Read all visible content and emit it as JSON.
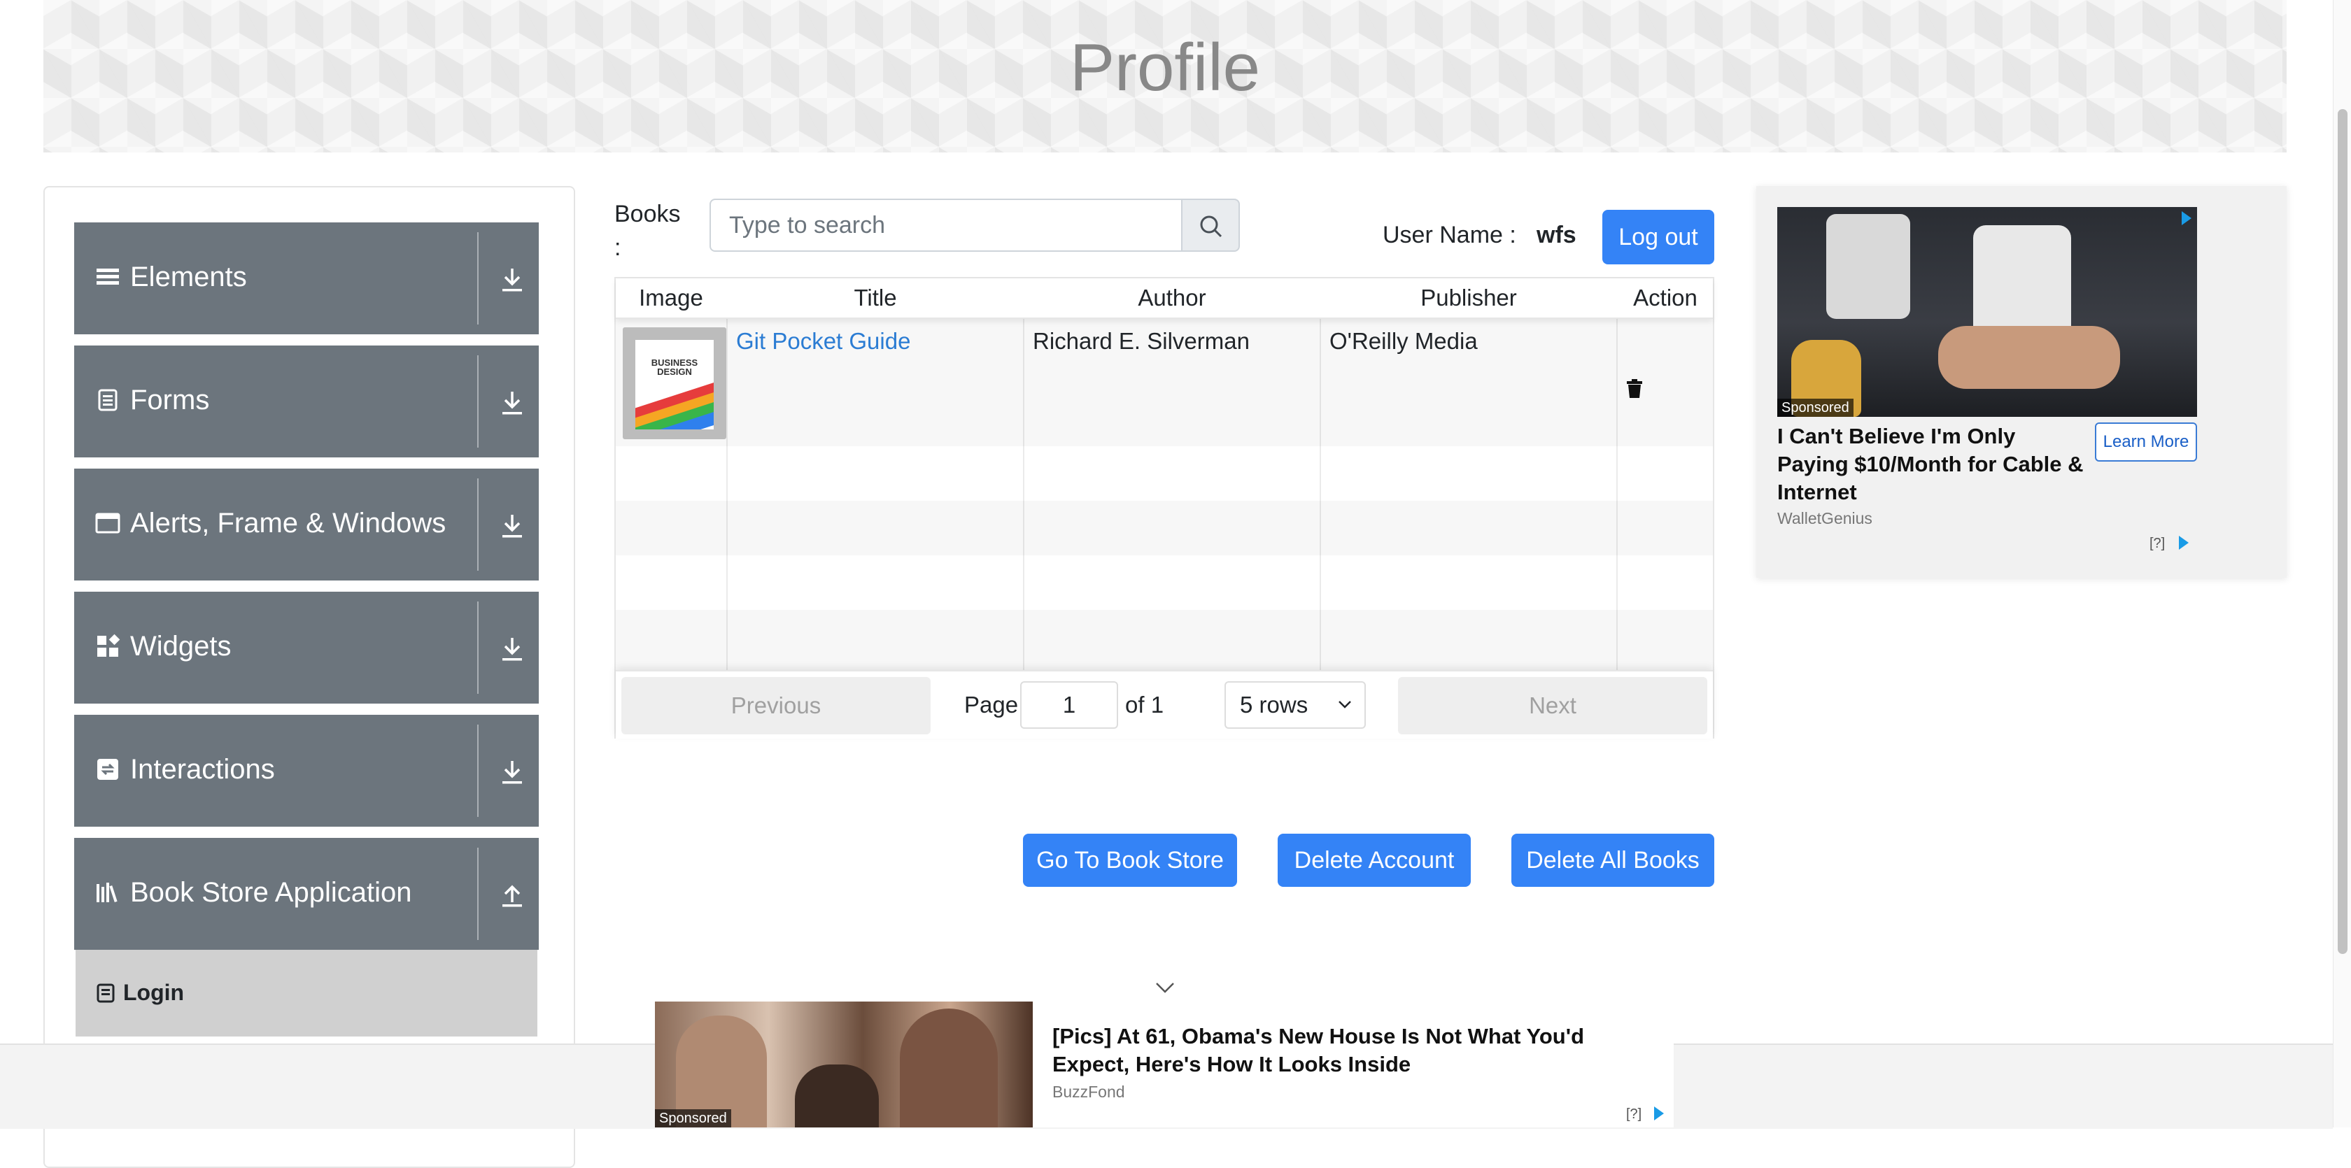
{
  "header": {
    "title": "Profile"
  },
  "sidebar": {
    "groups": [
      {
        "label": "Elements",
        "icon": "menu-icon",
        "arrow": "download-icon"
      },
      {
        "label": "Forms",
        "icon": "form-icon",
        "arrow": "download-icon"
      },
      {
        "label": "Alerts, Frame & Windows",
        "icon": "window-icon",
        "arrow": "download-icon"
      },
      {
        "label": "Widgets",
        "icon": "widgets-icon",
        "arrow": "download-icon"
      },
      {
        "label": "Interactions",
        "icon": "interactions-icon",
        "arrow": "download-icon"
      },
      {
        "label": "Book Store Application",
        "icon": "books-icon",
        "arrow": "upload-icon"
      }
    ],
    "active_item": {
      "label": "Login",
      "icon": "login-icon"
    }
  },
  "search": {
    "label": "Books :",
    "placeholder": "Type to search",
    "icon": "search-icon"
  },
  "user": {
    "name_label": "User Name :",
    "name_value": "wfs",
    "logout_label": "Log out"
  },
  "table": {
    "headers": [
      "Image",
      "Title",
      "Author",
      "Publisher",
      "Action"
    ],
    "rows": [
      {
        "image_text": "BUSINESS DESIGN",
        "title": "Git Pocket Guide",
        "author": "Richard E. Silverman",
        "publisher": "O'Reilly Media",
        "action_icon": "trash-icon"
      }
    ]
  },
  "pagination": {
    "previous_label": "Previous",
    "page_label": "Page",
    "page_value": "1",
    "of_label": "of 1",
    "rows_option": "5 rows",
    "next_label": "Next"
  },
  "actions": {
    "go_to_store": "Go To Book Store",
    "delete_account": "Delete Account",
    "delete_all": "Delete All Books"
  },
  "ad_right": {
    "sponsored": "Sponsored",
    "headline": "I Can't Believe I'm Only Paying $10/Month for Cable & Internet",
    "cta": "Learn More",
    "source": "WalletGenius",
    "adchoices": "[?]"
  },
  "ad_bottom": {
    "sponsored": "Sponsored",
    "headline": "[Pics] At 61, Obama's New House Is Not What You'd Expect, Here's How It Looks Inside",
    "source": "BuzzFond",
    "adchoices": "[?]"
  },
  "colors": {
    "primary": "#3483f6",
    "sidebar_group": "#6c757d",
    "link": "#2b7cd3",
    "active_item": "#d0d0d0"
  }
}
